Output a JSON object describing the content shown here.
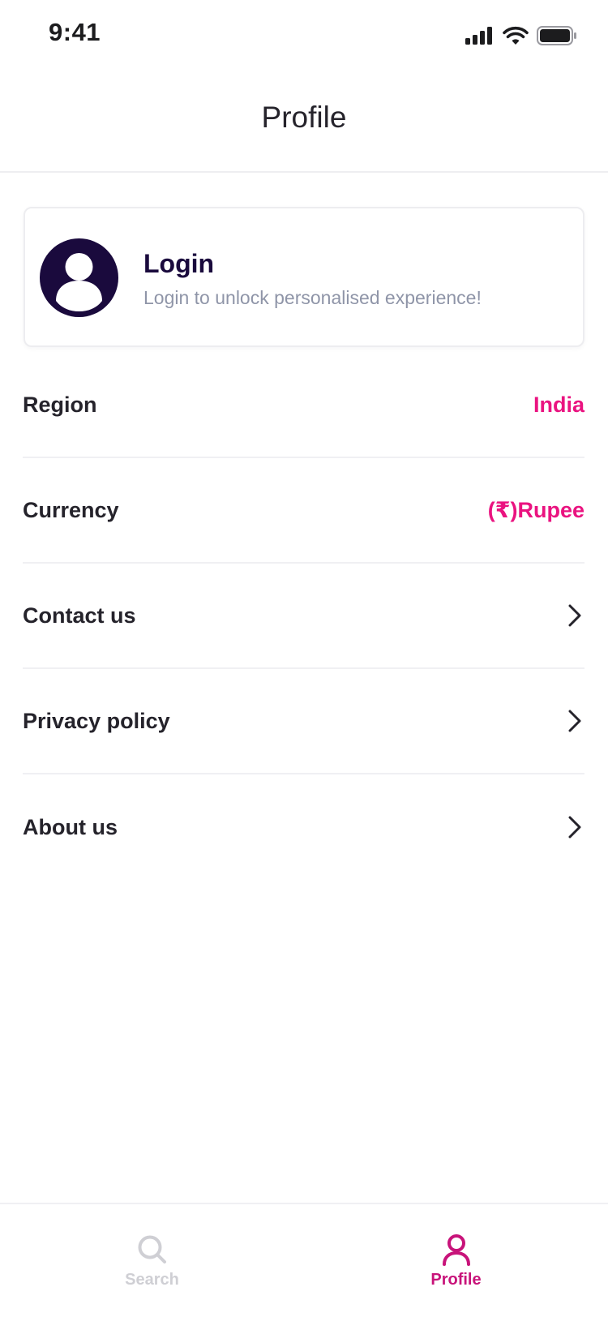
{
  "status_bar": {
    "time": "9:41"
  },
  "header": {
    "title": "Profile"
  },
  "login_card": {
    "title": "Login",
    "subtitle": "Login to unlock personalised experience!",
    "avatar_icon": "user-avatar-icon"
  },
  "menu": {
    "items": [
      {
        "label": "Region",
        "value": "India"
      },
      {
        "label": "Currency",
        "value": "(₹)Rupee"
      },
      {
        "label": "Contact us",
        "icon": "chevron-right-icon"
      },
      {
        "label": "Privacy policy",
        "icon": "chevron-right-icon"
      },
      {
        "label": "About us",
        "icon": "chevron-right-icon"
      }
    ]
  },
  "bottom_nav": {
    "items": [
      {
        "label": "Search",
        "icon": "search-icon",
        "active": false
      },
      {
        "label": "Profile",
        "icon": "user-icon",
        "active": true
      }
    ]
  },
  "colors": {
    "accent": "#ea1380",
    "nav_active": "#c8137a",
    "avatar_bg": "#1a0a3d",
    "subtitle_gray": "#8f95a8"
  }
}
